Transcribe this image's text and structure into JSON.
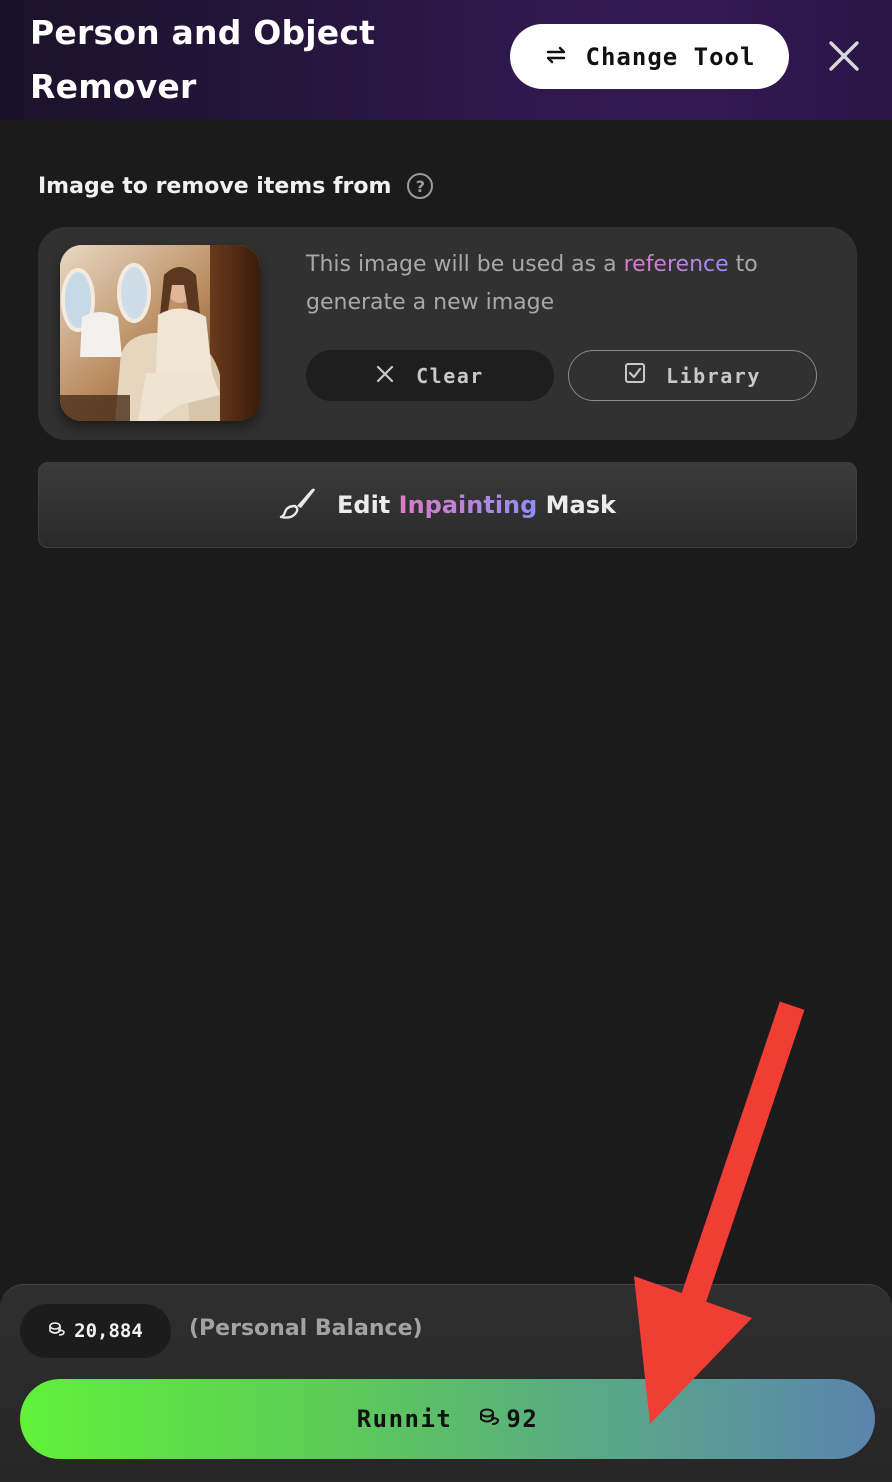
{
  "header": {
    "title_line1": "Person and Object",
    "title_line2": "Remover",
    "change_tool_label": "Change Tool"
  },
  "input_section": {
    "label": "Image to remove items from",
    "help": "?",
    "description_before": "This image will be used as a ",
    "description_accent": "reference",
    "description_after": " to generate a new image",
    "clear_label": "Clear",
    "library_label": "Library"
  },
  "edit_mask": {
    "prefix": "Edit",
    "accent": "Inpainting",
    "suffix": "Mask"
  },
  "footer": {
    "balance_value": "20,884",
    "balance_label": "(Personal Balance)",
    "runnit_label": "Runnit",
    "runnit_cost": "92"
  },
  "colors": {
    "background": "#1b1b1b",
    "card": "#313131",
    "accent_pink": "#e07ac5",
    "accent_purple": "#9b8cf2",
    "runnit_start": "#61f13b",
    "runnit_end": "#5a84ad",
    "annotation_arrow": "#f03e35"
  },
  "icons": [
    "swap-arrows-icon",
    "close-icon",
    "help-icon",
    "x-icon",
    "checkbox-icon",
    "brush-icon",
    "coins-icon"
  ]
}
